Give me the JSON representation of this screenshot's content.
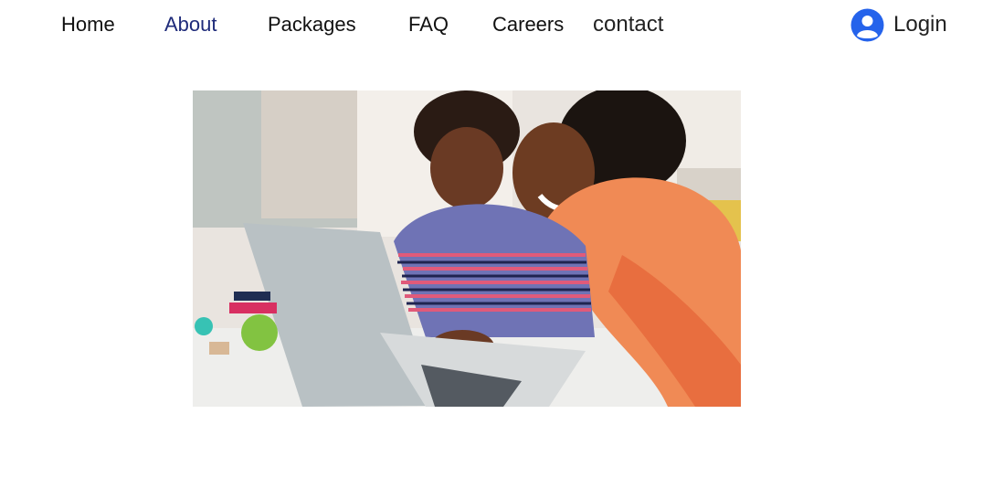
{
  "nav": {
    "items": [
      {
        "label": "Home"
      },
      {
        "label": "About"
      },
      {
        "label": "Packages"
      },
      {
        "label": "FAQ"
      },
      {
        "label": "Careers"
      },
      {
        "label": "contact"
      }
    ],
    "active": "About",
    "active_color": "#1f2b7a"
  },
  "login": {
    "label": "Login",
    "icon": "user-circle-icon",
    "icon_color": "#2563eb"
  },
  "hero": {
    "subject": "photo"
  }
}
